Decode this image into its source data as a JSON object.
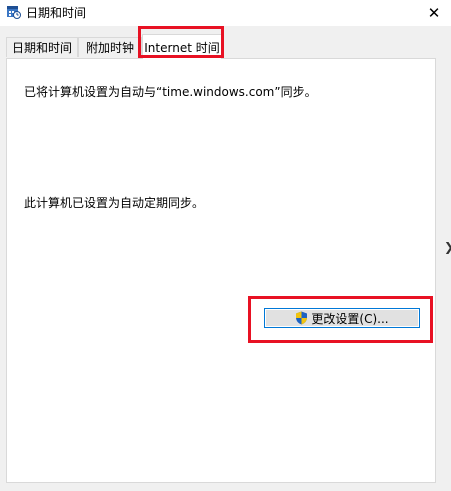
{
  "window": {
    "title": "日期和时间",
    "close_glyph": "✕"
  },
  "tabs": [
    {
      "label": "日期和时间",
      "active": false
    },
    {
      "label": "附加时钟",
      "active": false
    },
    {
      "label": "Internet 时间",
      "active": true
    }
  ],
  "panel": {
    "sync_message": "已将计算机设置为自动与“time.windows.com”同步。",
    "auto_message": "此计算机已设置为自动定期同步。",
    "change_button_label": "更改设置(C)...",
    "change_button_icon": "uac-shield-icon"
  },
  "colors": {
    "highlight": "#e81123",
    "focus_border": "#0078d7",
    "panel_bg": "#ffffff",
    "window_bg": "#f0f0f0"
  }
}
